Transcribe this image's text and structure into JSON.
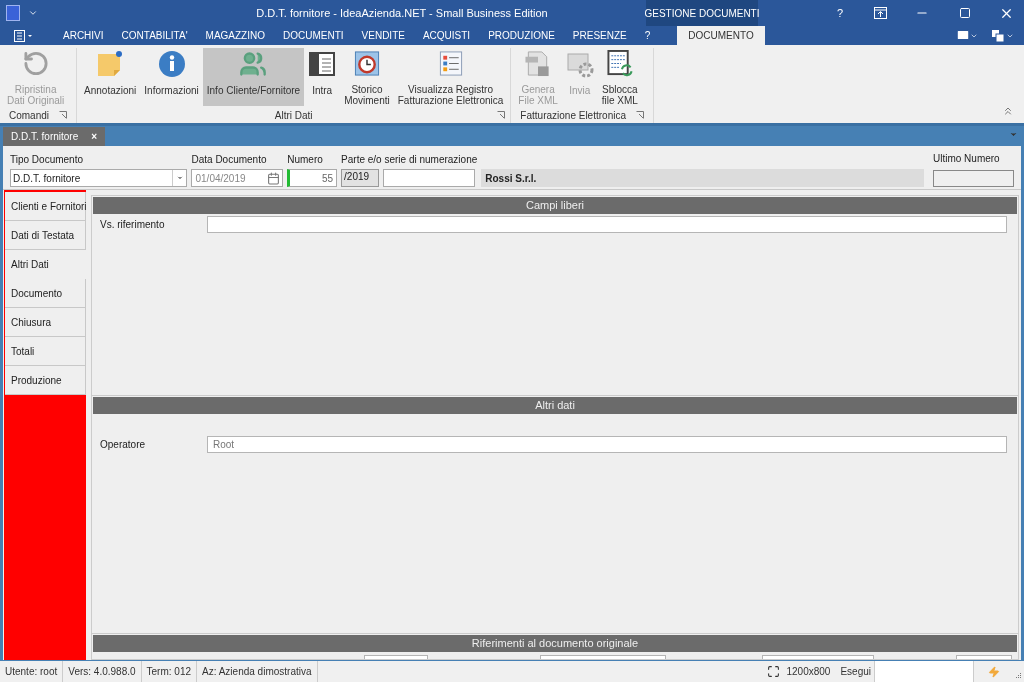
{
  "window": {
    "title": "D.D.T. fornitore - IdeaAzienda.NET - Small Business Edition",
    "context_tab": "GESTIONE DOCUMENTI",
    "help": "?"
  },
  "menu": [
    {
      "label": "ARCHIVI",
      "selected": false
    },
    {
      "label": "CONTABILITA'",
      "selected": false
    },
    {
      "label": "MAGAZZINO",
      "selected": false
    },
    {
      "label": "DOCUMENTI",
      "selected": false
    },
    {
      "label": "VENDITE",
      "selected": false
    },
    {
      "label": "ACQUISTI",
      "selected": false
    },
    {
      "label": "PRODUZIONE",
      "selected": false
    },
    {
      "label": "PRESENZE",
      "selected": false
    },
    {
      "label": "?",
      "selected": false
    },
    {
      "label": "DOCUMENTO",
      "selected": true
    }
  ],
  "ribbon": [
    {
      "label": "Comandi",
      "buttons": [
        {
          "kind": "undo",
          "lines": [
            "Ripristina",
            "Dati Originali"
          ],
          "disabled": true,
          "selected": false
        }
      ]
    },
    {
      "label": "Altri Dati",
      "buttons": [
        {
          "kind": "note",
          "lines": [
            "Annotazioni"
          ],
          "disabled": false,
          "selected": false
        },
        {
          "kind": "info",
          "lines": [
            "Informazioni"
          ],
          "disabled": false,
          "selected": false
        },
        {
          "kind": "people",
          "lines": [
            "Info Cliente/Fornitore"
          ],
          "disabled": false,
          "selected": true
        },
        {
          "kind": "panel",
          "lines": [
            "Intra"
          ],
          "disabled": false,
          "selected": false
        },
        {
          "kind": "clock",
          "lines": [
            "Storico",
            "Movimenti"
          ],
          "disabled": false,
          "selected": false
        },
        {
          "kind": "list",
          "lines": [
            "Visualizza Registro",
            "Fatturazione Elettronica"
          ],
          "disabled": false,
          "selected": false
        }
      ]
    },
    {
      "label": "Fatturazione Elettronica",
      "buttons": [
        {
          "kind": "xml",
          "lines": [
            "Genera",
            "File XML"
          ],
          "disabled": true,
          "selected": false
        },
        {
          "kind": "send",
          "lines": [
            "Invia"
          ],
          "disabled": true,
          "selected": false
        },
        {
          "kind": "sheet",
          "lines": [
            "Sblocca",
            "file XML"
          ],
          "disabled": false,
          "selected": false
        }
      ]
    }
  ],
  "document_tab": {
    "label": "D.D.T. fornitore",
    "close": "×"
  },
  "header": {
    "tipo_documento": {
      "label": "Tipo Documento",
      "value": "D.D.T. fornitore"
    },
    "data_documento": {
      "label": "Data Documento",
      "value": "01/04/2019"
    },
    "numero": {
      "label": "Numero",
      "value": "55"
    },
    "serie": {
      "label": "Parte e/o serie di numerazione",
      "prefix": "/2019"
    },
    "cliente": "Rossi S.r.l.",
    "ultimo_numero": {
      "label": "Ultimo Numero"
    }
  },
  "sidebar": [
    {
      "label": "Clienti e Fornitori",
      "selected": false
    },
    {
      "label": "Dati di Testata",
      "selected": false
    },
    {
      "label": "Altri Dati",
      "selected": true
    },
    {
      "label": "Documento",
      "selected": false
    },
    {
      "label": "Chiusura",
      "selected": false
    },
    {
      "label": "Totali",
      "selected": false
    },
    {
      "label": "Produzione",
      "selected": false
    }
  ],
  "sections": [
    {
      "title": "Campi liberi",
      "fields": [
        {
          "label": "Vs. riferimento"
        }
      ]
    },
    {
      "title": "Altri dati",
      "fields": [
        {
          "label": "Operatore",
          "value": "Root"
        }
      ]
    },
    {
      "title": "Riferimenti al documento originale"
    }
  ],
  "status_bar": {
    "items": [
      "Utente: root",
      "Vers: 4.0.988.0",
      "Term: 012",
      "Az: Azienda dimostrativa"
    ],
    "resolution": "1200x800",
    "run_label": "Esegui"
  }
}
